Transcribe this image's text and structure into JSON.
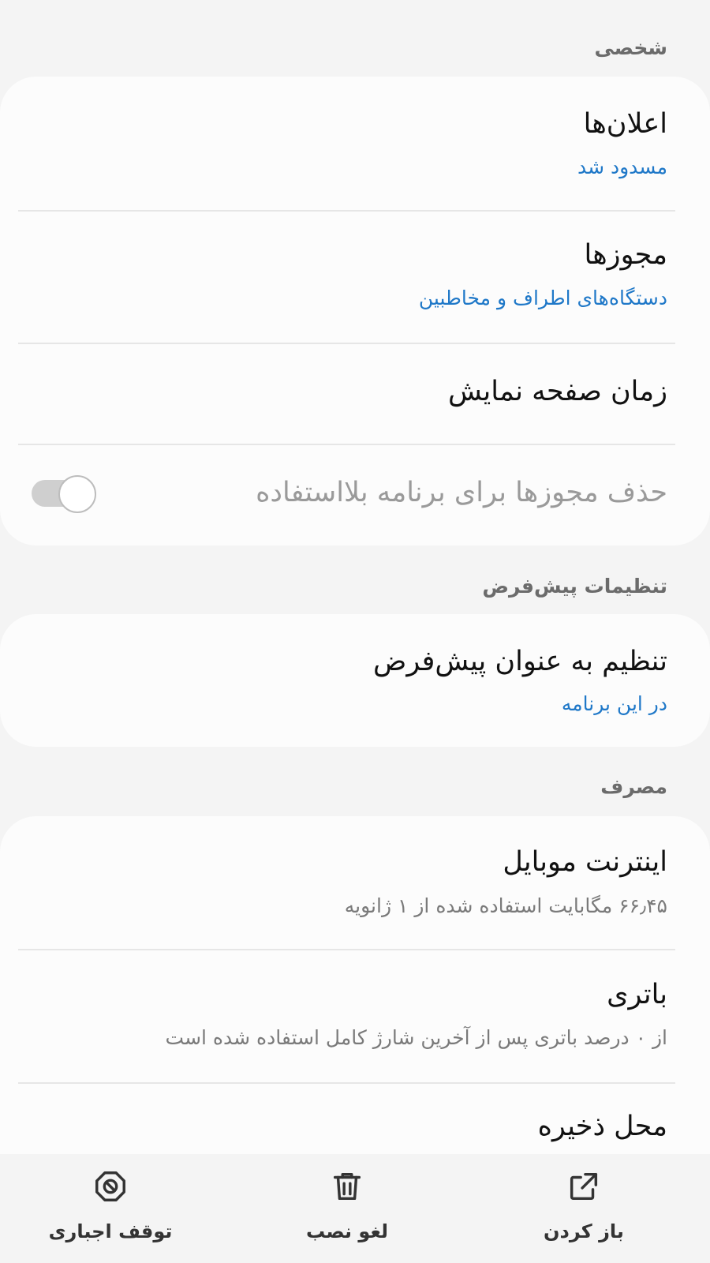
{
  "sections": {
    "personal": {
      "header": "شخصی",
      "notifications": {
        "title": "اعلان‌ها",
        "subtitle": "مسدود شد"
      },
      "permissions": {
        "title": "مجوزها",
        "subtitle": "دستگاه‌های اطراف و مخاطبین"
      },
      "screen_time": {
        "title": "زمان صفحه نمایش"
      },
      "remove_permissions": {
        "title": "حذف مجوزها برای برنامه بلااستفاده",
        "toggle_on": true,
        "enabled": false
      }
    },
    "defaults": {
      "header": "تنظیمات پیش‌فرض",
      "set_default": {
        "title": "تنظیم به عنوان پیش‌فرض",
        "subtitle": "در این برنامه"
      }
    },
    "usage": {
      "header": "مصرف",
      "mobile_data": {
        "title": "اینترنت موبایل",
        "subtitle": "۶۶٫۴۵ مگابایت استفاده شده از ۱ ژانویه"
      },
      "battery": {
        "title": "باتری",
        "subtitle": "از ۰ درصد باتری پس از آخرین شارژ کامل استفاده شده است"
      },
      "storage": {
        "title": "محل ذخیره"
      }
    }
  },
  "actions": {
    "open": {
      "label": "باز کردن",
      "icon": "open-external-icon"
    },
    "uninstall": {
      "label": "لغو نصب",
      "icon": "trash-icon"
    },
    "force_stop": {
      "label": "توقف اجباری",
      "icon": "force-stop-icon"
    }
  },
  "colors": {
    "background": "#f4f4f4",
    "card": "#fcfcfc",
    "accent_blue": "#1f78c8",
    "subtitle_gray": "#7a7a7a"
  }
}
